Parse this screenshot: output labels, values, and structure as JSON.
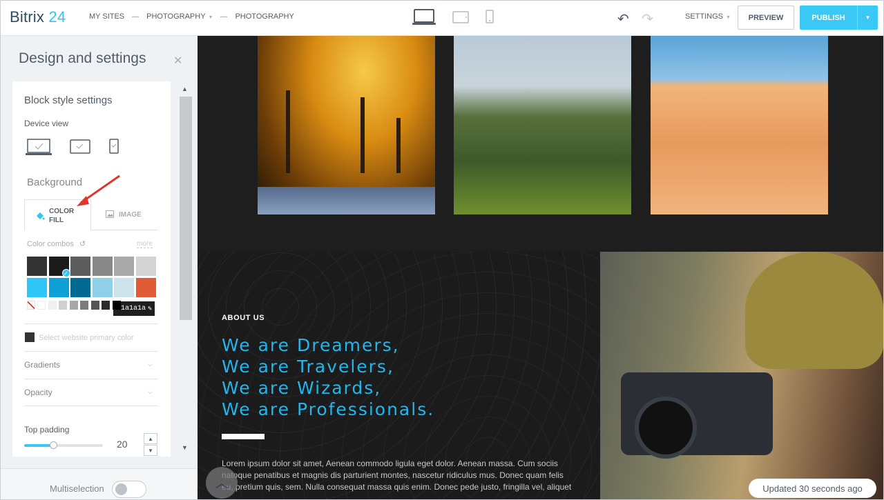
{
  "app": {
    "logo_text": "Bitrix",
    "logo_number": "24"
  },
  "breadcrumbs": [
    "MY SITES",
    "PHOTOGRAPHY",
    "PHOTOGRAPHY"
  ],
  "toolbar": {
    "settings_label": "SETTINGS",
    "preview_label": "PREVIEW",
    "publish_label": "PUBLISH",
    "device_icons": [
      "desktop-icon",
      "tablet-icon",
      "mobile-icon"
    ]
  },
  "panel": {
    "title": "Design and settings",
    "section_title": "Block style settings",
    "device_view_label": "Device view",
    "background_label": "Background",
    "tabs": {
      "color_fill": "COLOR FILL",
      "image": "IMAGE"
    },
    "color_combos_label": "Color combos",
    "more_label": "more",
    "swatch_colors": [
      "#333333",
      "#1a1a1a",
      "#5d5d5d",
      "#878787",
      "#a9a9a9",
      "#d4d4d4",
      "#2fc6f6",
      "#10a0d8",
      "#036a94",
      "#8fd0e8",
      "#cde3ec",
      "#e05b36"
    ],
    "mini_swatch_colors": [
      "#ffffff",
      "#f0f0f0",
      "#d0d0d0",
      "#a8a8a8",
      "#7c7c7c",
      "#555555",
      "#2b2b2b",
      "#000000"
    ],
    "selected_hex": "#1a1a1a",
    "primary_color_label": "Select website primary color",
    "gradients_label": "Gradients",
    "opacity_label": "Opacity",
    "top_padding_label": "Top padding",
    "top_padding_value": "20",
    "multiselection_label": "Multiselection"
  },
  "content": {
    "about_label": "ABOUT US",
    "headlines": [
      "We are Dreamers,",
      "We are Travelers,",
      "We are Wizards,",
      "We are Professionals."
    ],
    "lorem_lines": [
      "Lorem ipsum dolor sit amet, Aenean commodo ligula eget dolor. Aenean massa. Cum sociis",
      "natoque penatibus et magnis dis parturient montes, nascetur ridiculus mus. Donec quam felis",
      "eu, pretium quis, sem. Nulla consequat massa quis enim. Donec pede justo, fringilla vel, aliquet"
    ],
    "updated_text": "Updated 30 seconds ago"
  },
  "colors": {
    "accent": "#3bc8f5",
    "headline": "#21b6ee",
    "dark_bg": "#1e1e1e"
  }
}
